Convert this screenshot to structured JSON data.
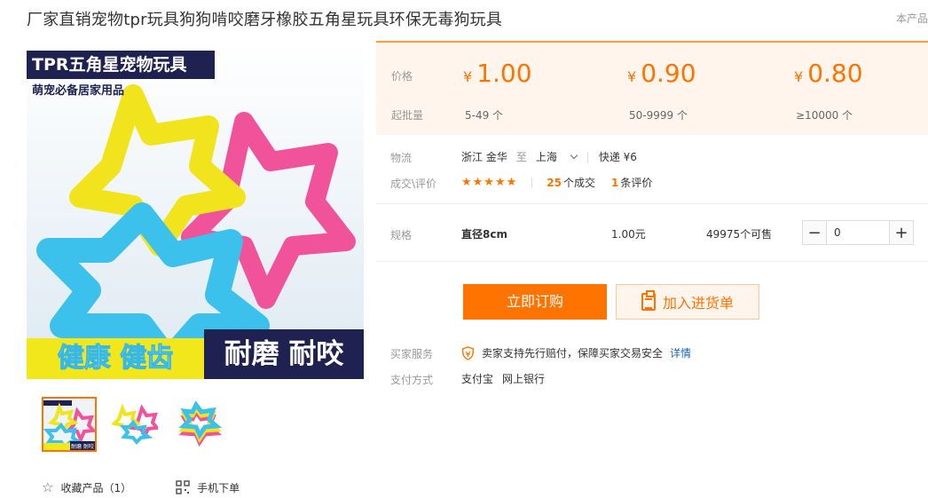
{
  "product": {
    "title": "厂家直销宠物tpr玩具狗狗啃咬磨牙橡胶五角星玩具环保无毒狗玩具",
    "corner_tag": "本产品"
  },
  "image": {
    "banner": "TPR五角星宠物玩具",
    "subtitle": "萌宠必备居家用品",
    "bottom_left": "健康 健齿",
    "bottom_right": "耐磨 耐咬"
  },
  "thumb_captions": {
    "first": "耐磨 耐咬"
  },
  "actions": {
    "favorite": "收藏产品（1）",
    "mobile_order": "手机下单"
  },
  "pricing": {
    "price_label": "价格",
    "moq_label": "起批量",
    "currency": "¥",
    "tiers": [
      {
        "price": "1.00",
        "moq": "5-49 个"
      },
      {
        "price": "0.90",
        "moq": "50-9999 个"
      },
      {
        "price": "0.80",
        "moq": "≥10000 个"
      }
    ]
  },
  "logistics": {
    "label": "物流",
    "from": "浙江 金华",
    "to_word": "至",
    "dest": "上海",
    "shipping": "快递 ¥6"
  },
  "reviews": {
    "label": "成交\\评价",
    "stars": "★★★★★",
    "deals_count": "25",
    "deals_text": "个成交",
    "review_count": "1",
    "review_text": "条评价"
  },
  "spec": {
    "label": "规格",
    "name": "直径8cm",
    "price": "1.00元",
    "stock": "49975个可售",
    "quantity": "0"
  },
  "buttons": {
    "order": "立即订购",
    "cart": "加入进货单"
  },
  "service": {
    "label": "买家服务",
    "text": "卖家支持先行赔付，保障买家交易安全",
    "link": "详情"
  },
  "payment": {
    "label": "支付方式",
    "methods": [
      "支付宝",
      "网上银行"
    ]
  },
  "colors": {
    "accent": "#ff7300",
    "price_bg": "#fff5ec",
    "link": "#1a63b5"
  }
}
